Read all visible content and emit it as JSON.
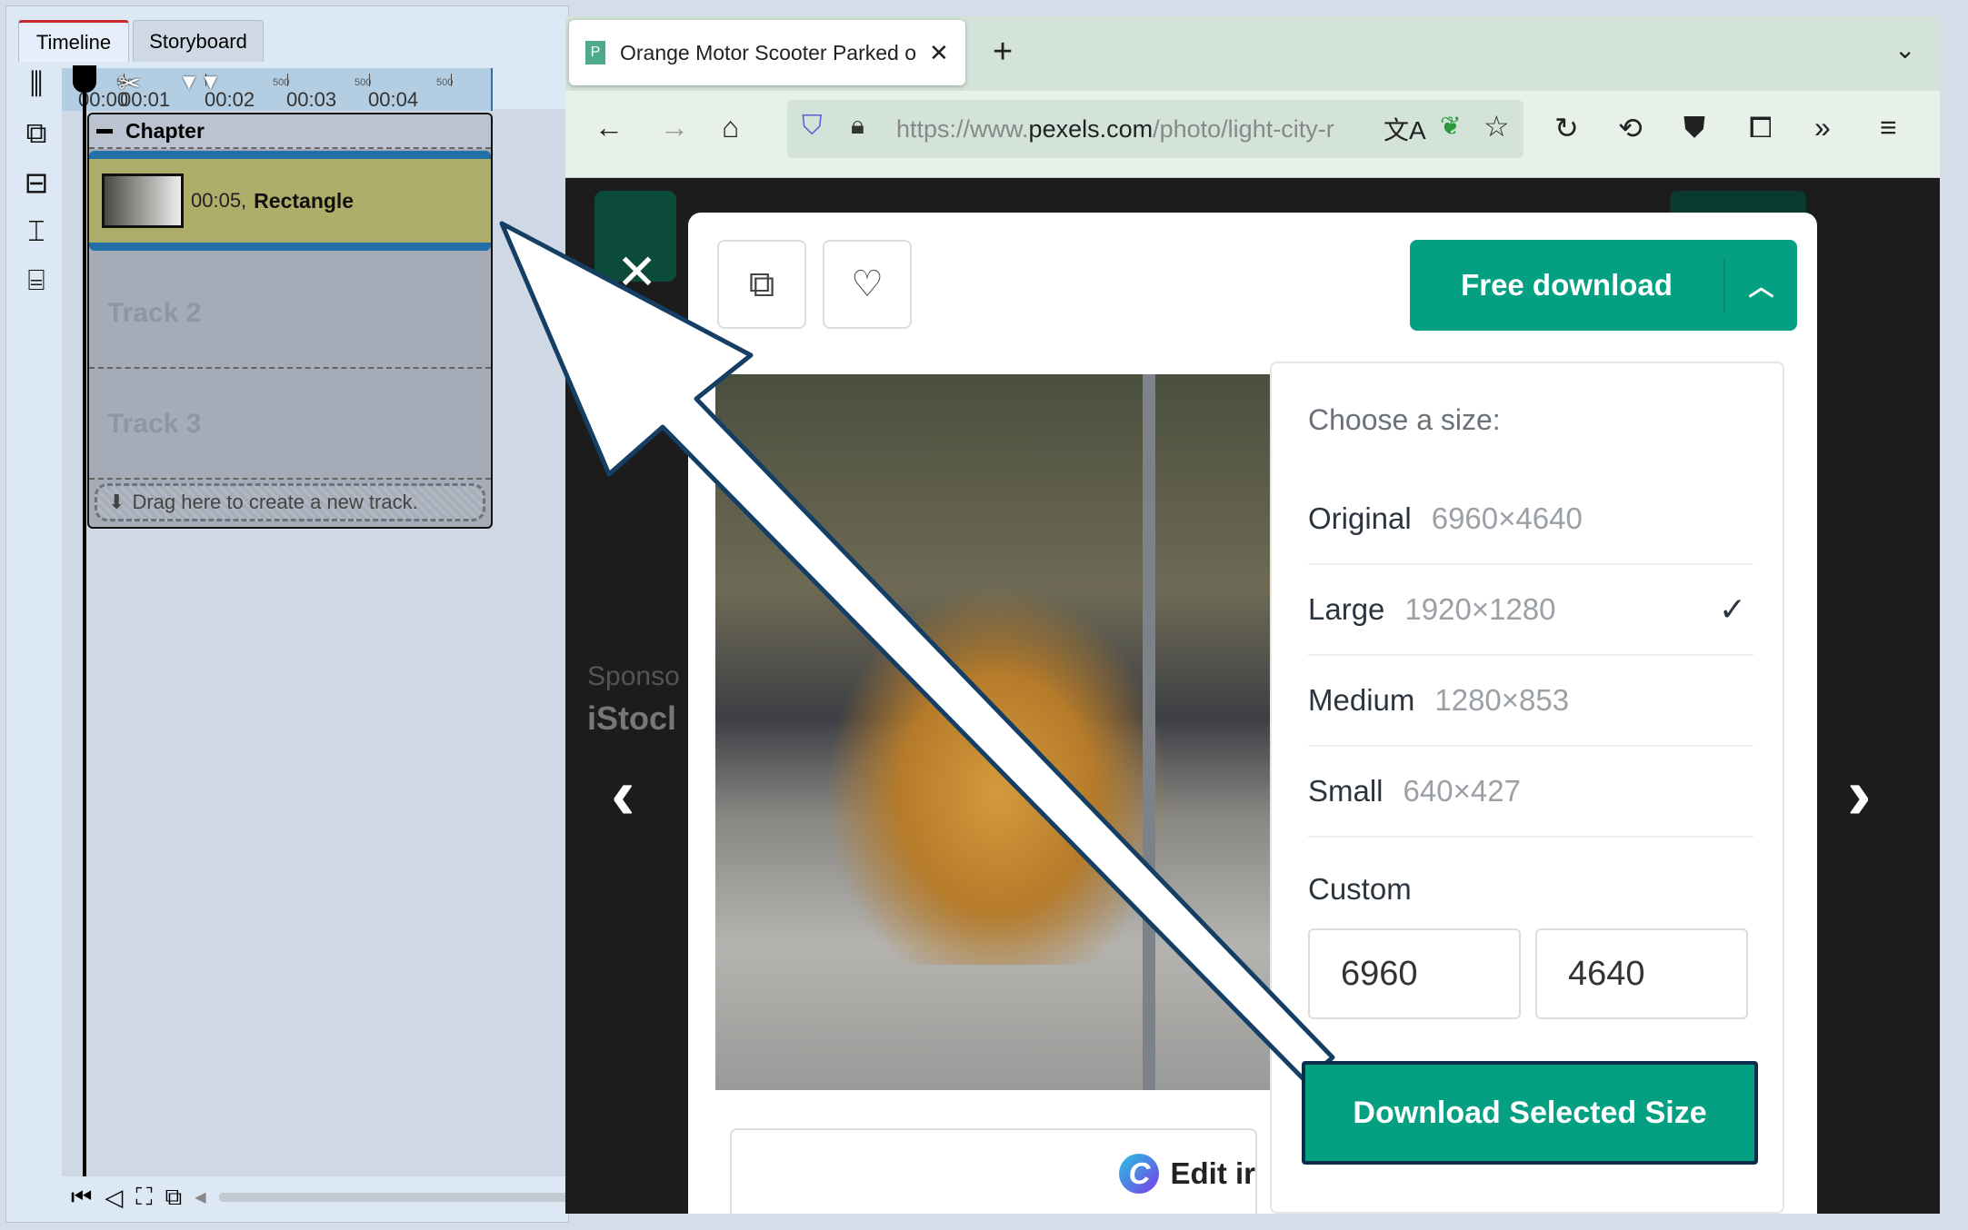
{
  "editor": {
    "tabs": [
      {
        "label": "Timeline",
        "active": true
      },
      {
        "label": "Storyboard",
        "active": false
      }
    ],
    "tools": [
      "split-tracks-icon",
      "add-track-icon",
      "remove-track-icon",
      "fit-tracks-icon",
      "expand-tracks-icon"
    ],
    "ruler": {
      "labels": [
        "00:00",
        "00:01",
        "00:02",
        "00:03",
        "00:04"
      ],
      "minor": "500"
    },
    "chapter": "Chapter",
    "clip": {
      "time": "00:05,",
      "name": "Rectangle"
    },
    "tracks": [
      "Track 2",
      "Track 3"
    ],
    "new_track_hint": "Drag here to create a new track."
  },
  "browser": {
    "tab_title": "Orange Motor Scooter Parked o",
    "url_prefix": "https://www.",
    "url_domain": "pexels.com",
    "url_path": "/photo/light-city-r",
    "page": {
      "sponsor_text": "Sponso",
      "sponsor_brand": "iStocl",
      "free_download": "Free download",
      "choose_size": "Choose a size:",
      "sizes": [
        {
          "name": "Original",
          "dims": "6960×4640",
          "selected": false
        },
        {
          "name": "Large",
          "dims": "1920×1280",
          "selected": true
        },
        {
          "name": "Medium",
          "dims": "1280×853",
          "selected": false
        },
        {
          "name": "Small",
          "dims": "640×427",
          "selected": false
        }
      ],
      "custom_label": "Custom",
      "custom_width": "6960",
      "custom_height": "4640",
      "download_selected": "Download Selected Size",
      "edit_in": "Edit ir"
    },
    "accent": "#05a081"
  }
}
